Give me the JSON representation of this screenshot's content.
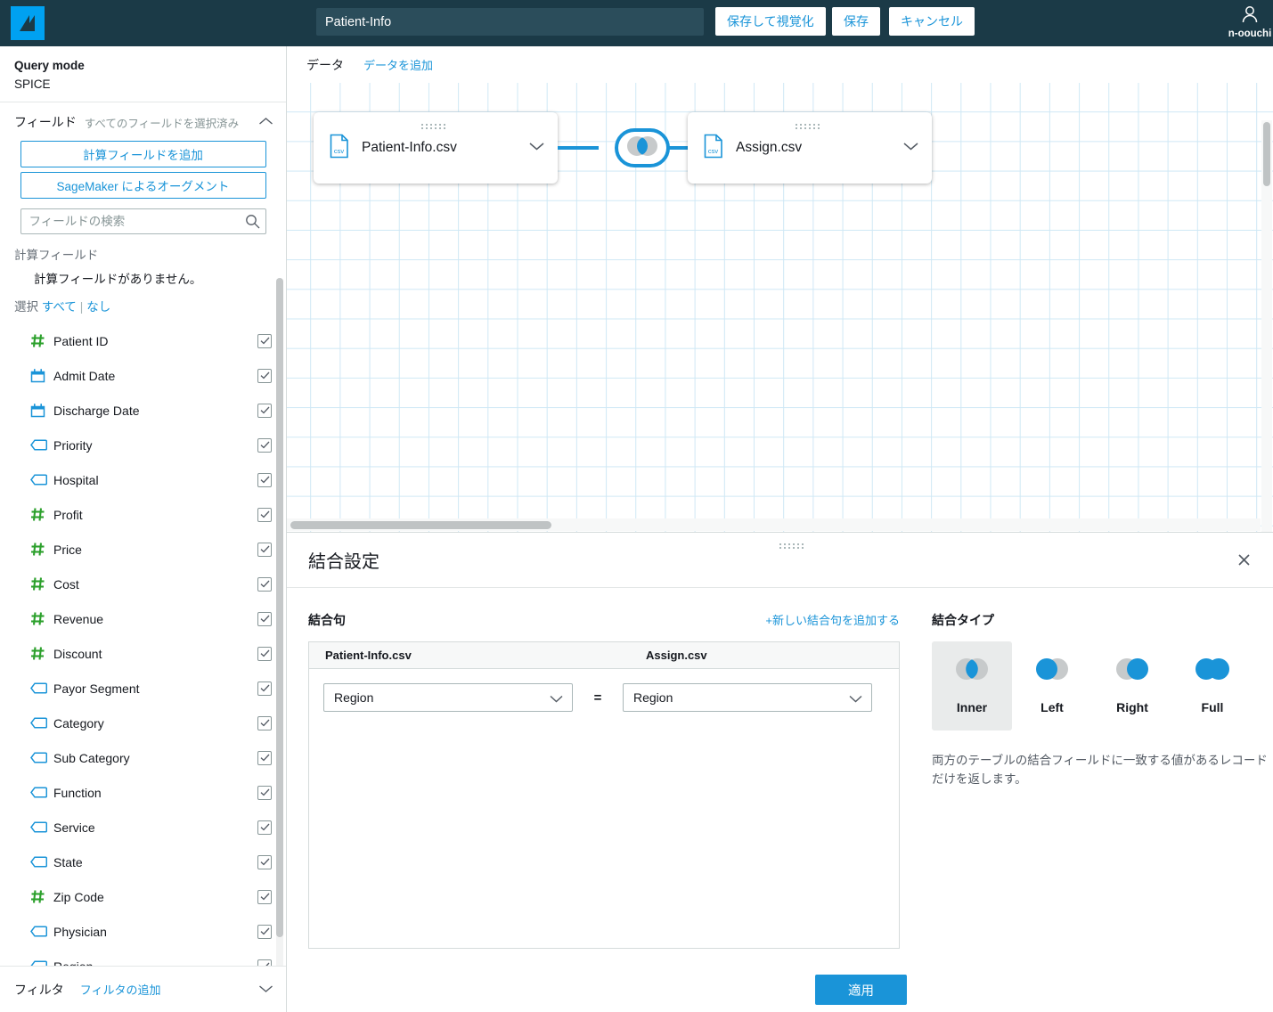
{
  "topbar": {
    "logo_icon": "quicksight-logo-icon",
    "title_value": "Patient-Info",
    "title_placeholder": "Patient-Info",
    "save_and_visualize_label": "保存して視覚化",
    "save_label": "保存",
    "cancel_label": "キャンセル",
    "user_icon": "user-avatar-icon",
    "user_name": "n-oouchi"
  },
  "sidebar": {
    "query_mode_title": "Query mode",
    "query_mode_value": "SPICE",
    "fields_title": "フィールド",
    "fields_subtitle": "すべてのフィールドを選択済み",
    "collapse_icon": "chevron-up-icon",
    "add_calculated_field_label": "計算フィールドを追加",
    "sagemaker_augment_label": "SageMaker によるオーグメント",
    "search_placeholder": "フィールドの検索",
    "search_value": "",
    "search_icon": "search-icon",
    "calculated_fields_label": "計算フィールド",
    "calculated_fields_empty": "計算フィールドがありません。",
    "select_label": "選択",
    "select_all_label": "すべて",
    "select_none_label": "なし",
    "fields": [
      {
        "name": "Patient ID",
        "type": "number",
        "checked": true
      },
      {
        "name": "Admit Date",
        "type": "date",
        "checked": true
      },
      {
        "name": "Discharge Date",
        "type": "date",
        "checked": true
      },
      {
        "name": "Priority",
        "type": "string",
        "checked": true
      },
      {
        "name": "Hospital",
        "type": "string",
        "checked": true
      },
      {
        "name": "Profit",
        "type": "number",
        "checked": true
      },
      {
        "name": "Price",
        "type": "number",
        "checked": true
      },
      {
        "name": "Cost",
        "type": "number",
        "checked": true
      },
      {
        "name": "Revenue",
        "type": "number",
        "checked": true
      },
      {
        "name": "Discount",
        "type": "number",
        "checked": true
      },
      {
        "name": "Payor Segment",
        "type": "string",
        "checked": true
      },
      {
        "name": "Category",
        "type": "string",
        "checked": true
      },
      {
        "name": "Sub Category",
        "type": "string",
        "checked": true
      },
      {
        "name": "Function",
        "type": "string",
        "checked": true
      },
      {
        "name": "Service",
        "type": "string",
        "checked": true
      },
      {
        "name": "State",
        "type": "string",
        "checked": true
      },
      {
        "name": "Zip Code",
        "type": "number",
        "checked": true
      },
      {
        "name": "Physician",
        "type": "string",
        "checked": true
      },
      {
        "name": "Region",
        "type": "string",
        "checked": true
      }
    ],
    "filter_title": "フィルタ",
    "filter_add_label": "フィルタの追加",
    "filter_expand_icon": "chevron-down-icon"
  },
  "canvas": {
    "tab_data_label": "データ",
    "add_data_label": "データを追加",
    "nodes": [
      {
        "label": "Patient-Info.csv",
        "icon": "csv-file-icon",
        "chevron": "chevron-down-icon"
      },
      {
        "label": "Assign.csv",
        "icon": "csv-file-icon",
        "chevron": "chevron-down-icon"
      }
    ],
    "join_icon": "inner-join-icon"
  },
  "join_panel": {
    "title": "結合設定",
    "close_icon": "close-icon",
    "clause_title": "結合句",
    "add_clause_label": "+新しい結合句を追加する",
    "table_headers": [
      "Patient-Info.csv",
      "Assign.csv"
    ],
    "left_select_value": "Region",
    "right_select_value": "Region",
    "equals_symbol": "=",
    "join_type_title": "結合タイプ",
    "join_types": [
      {
        "label": "Inner",
        "icon": "inner-join-icon",
        "selected": true
      },
      {
        "label": "Left",
        "icon": "left-join-icon",
        "selected": false
      },
      {
        "label": "Right",
        "icon": "right-join-icon",
        "selected": false
      },
      {
        "label": "Full",
        "icon": "full-join-icon",
        "selected": false
      }
    ],
    "join_type_description": "両方のテーブルの結合フィールドに一致する値があるレコードだけを返します。",
    "apply_label": "適用"
  },
  "colors": {
    "brand_dark": "#1b3a47",
    "accent_blue": "#1a94d8",
    "logo_blue": "#00a1f1",
    "number_field_green": "#2ca02c",
    "grid_line": "#cfe8f5"
  }
}
